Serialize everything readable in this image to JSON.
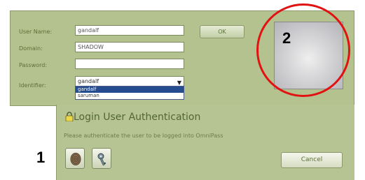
{
  "login": {
    "username_label": "User Name:",
    "username_value": "gandalf",
    "domain_label": "Domain:",
    "domain_value": "SHADOW",
    "password_label": "Password:",
    "password_value": "",
    "identifier_label": "Identifier:",
    "identifier_value": "gandalf",
    "ok_label": "OK",
    "identifier_options": [
      "gandalf",
      "saruman"
    ],
    "identifier_selected": "gandalf"
  },
  "auth": {
    "title": "Login User Authentication",
    "message": "Please authenticate the user to be logged into OmniPass",
    "cancel_label": "Cancel"
  },
  "markers": {
    "one": "1",
    "two": "2"
  },
  "colors": {
    "panel": "#b3c28e",
    "marker": "#e21212"
  },
  "icons": [
    "fingerprint-icon",
    "key-icon",
    "lock-icon",
    "chevron-down-icon"
  ]
}
